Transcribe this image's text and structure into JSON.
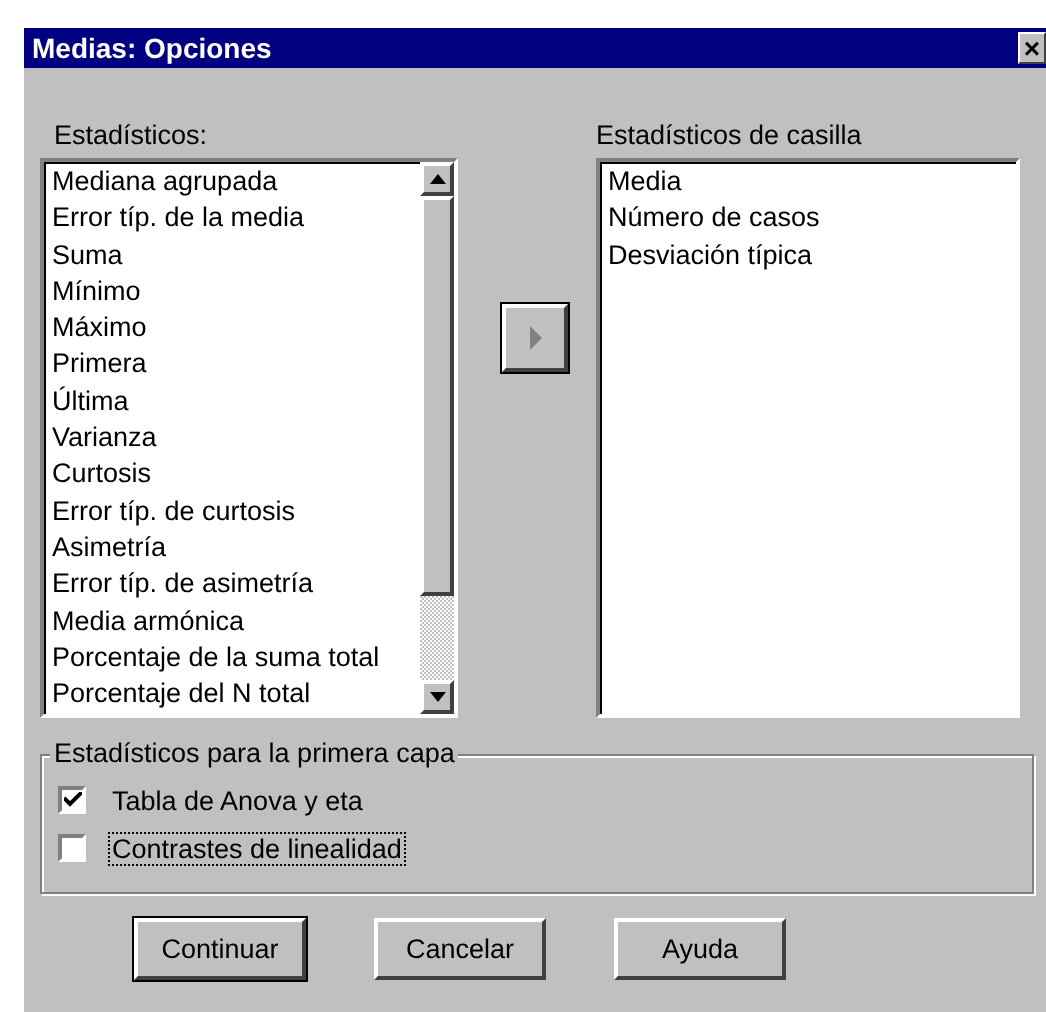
{
  "window": {
    "title": "Medias: Opciones",
    "close": "×"
  },
  "statistics": {
    "label": "Estadísticos:",
    "items": [
      "Mediana agrupada",
      "Error típ. de la media",
      "Suma",
      "Mínimo",
      "Máximo",
      "Primera",
      "Última",
      "Varianza",
      "Curtosis",
      "Error típ. de curtosis",
      "Asimetría",
      "Error típ. de asimetría",
      "Media armónica",
      "Porcentaje de la suma total",
      "Porcentaje del N total"
    ]
  },
  "cell_statistics": {
    "label": "Estadísticos de casilla",
    "items": [
      "Media",
      "Número de casos",
      "Desviación típica"
    ]
  },
  "first_layer": {
    "label": "Estadísticos para la primera capa",
    "options": [
      {
        "label": "Tabla de Anova y eta",
        "checked": true,
        "focused": false
      },
      {
        "label": "Contrastes de linealidad",
        "checked": false,
        "focused": true
      }
    ]
  },
  "buttons": [
    {
      "label": "Continuar",
      "default": true
    },
    {
      "label": "Cancelar",
      "default": false
    },
    {
      "label": "Ayuda",
      "default": false
    }
  ]
}
